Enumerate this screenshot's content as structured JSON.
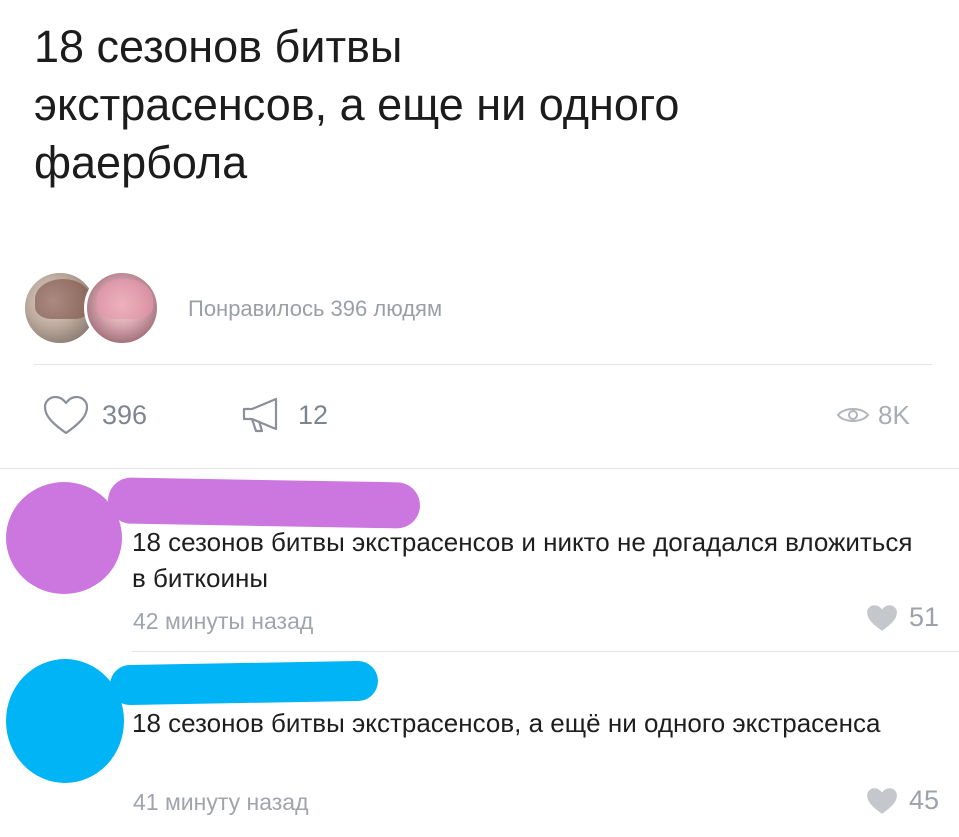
{
  "post": {
    "text": "18 сезонов битвы\nэкстрасенсов, а еще ни одного\nфаербола"
  },
  "likes": {
    "summary": "Понравилось 396 людям"
  },
  "actions": {
    "likes_count": "396",
    "reposts_count": "12",
    "views_count": "8K"
  },
  "comments": [
    {
      "text": "18 сезонов битвы экстрасенсов и никто не догадался вложиться в биткоины",
      "time": "42 минуты назад",
      "likes": "51",
      "avatar_color": "#cc77e0"
    },
    {
      "text": "18 сезонов битвы экстрасенсов, а ещё ни одного экстрасенса",
      "time": "41 минуту назад",
      "likes": "45",
      "avatar_color": "#00b4f5"
    }
  ],
  "colors": {
    "icon_gray": "#8a9099",
    "light_icon_gray": "#c4c7cc",
    "divider": "#e3e4e8"
  }
}
